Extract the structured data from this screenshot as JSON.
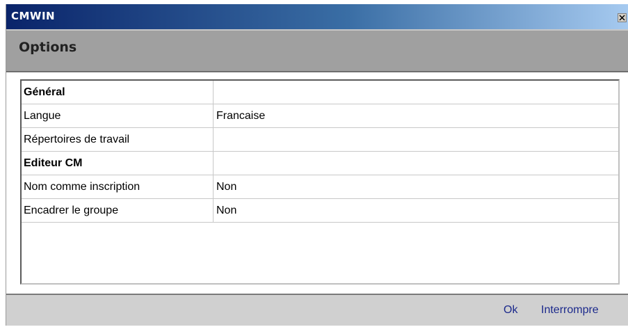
{
  "window": {
    "title": "CMWIN"
  },
  "header": {
    "title": "Options"
  },
  "grid": {
    "rows": [
      {
        "name": "Général",
        "value": "",
        "section": true
      },
      {
        "name": "Langue",
        "value": "Francaise",
        "section": false
      },
      {
        "name": "Répertoires de travail",
        "value": "",
        "section": false
      },
      {
        "name": "Editeur CM",
        "value": "",
        "section": true
      },
      {
        "name": "Nom comme inscription",
        "value": "Non",
        "section": false
      },
      {
        "name": "Encadrer le groupe",
        "value": "Non",
        "section": false
      }
    ]
  },
  "footer": {
    "ok_label": "Ok",
    "cancel_label": "Interrompre"
  },
  "colors": {
    "titlebar_start": "#0a246a",
    "titlebar_end": "#a6caf0",
    "header_bg": "#a0a0a0",
    "link_text": "#1c2a8c"
  },
  "icons": {
    "close": "close-icon"
  }
}
